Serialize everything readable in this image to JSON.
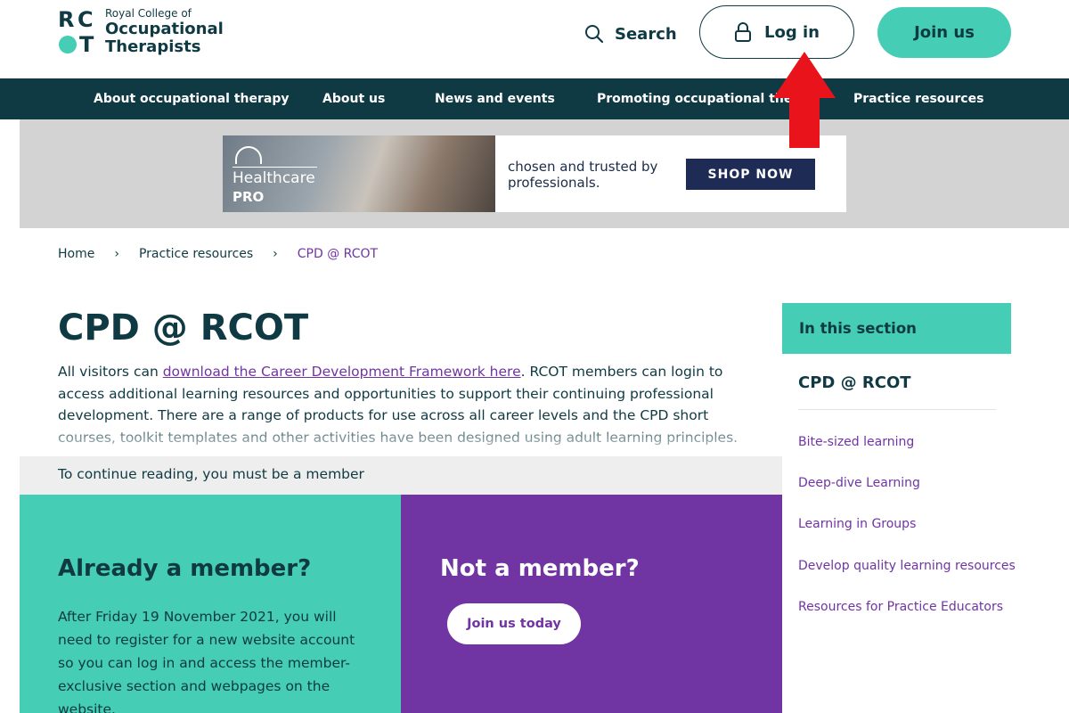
{
  "logo": {
    "mark_letters": [
      "R",
      "C",
      "T"
    ],
    "line1": "Royal College of",
    "line2": "Occupational",
    "line3": "Therapists"
  },
  "header": {
    "search_label": "Search",
    "login_label": "Log in",
    "join_label": "Join us"
  },
  "nav": {
    "items": [
      "About occupational therapy",
      "About us",
      "News and events",
      "Promoting occupational therapy",
      "Practice resources"
    ]
  },
  "ad": {
    "brand_line1": "Healthcare",
    "brand_line2": "PRO",
    "tagline": "chosen and trusted by professionals.",
    "cta": "SHOP NOW"
  },
  "breadcrumb": {
    "items": [
      "Home",
      "Practice resources"
    ],
    "current": "CPD @ RCOT",
    "separator": "›"
  },
  "main": {
    "title": "CPD @ RCOT",
    "intro_prefix": "All visitors can ",
    "intro_link": "download the Career Development Framework here",
    "intro_suffix": ". RCOT members can login to access additional  learning resources and opportunities to support their continuing professional development. There are a range of products for use across all career levels and the CPD short courses, toolkit templates and other activities have been designed using adult learning principles."
  },
  "paywall": {
    "continue_text": "To continue reading, you must be a member",
    "member_title": "Already a member?",
    "member_text": "After Friday 19 November 2021, you will need to register for a new website account so you can log in and access the member-exclusive section and webpages on the website.",
    "nonmember_title": "Not a member?",
    "join_today": "Join us today"
  },
  "sidebar": {
    "heading": "In this section",
    "current": "CPD @ RCOT",
    "links": [
      "Bite-sized learning",
      "Deep-dive Learning",
      "Learning in Groups",
      "Develop quality learning resources",
      "Resources for Practice Educators"
    ]
  },
  "colors": {
    "navy": "#0f3a43",
    "teal": "#45cdb5",
    "purple": "#7034a3",
    "annotation_red": "#e8131b"
  }
}
